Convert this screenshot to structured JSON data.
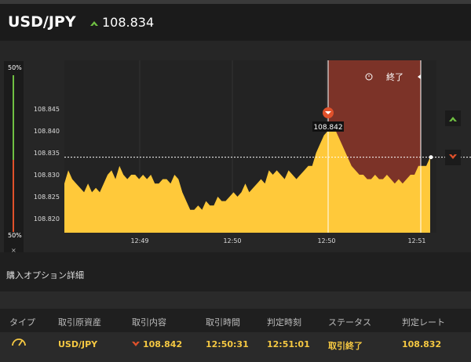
{
  "header": {
    "pair": "USD/JPY",
    "price": "108.834"
  },
  "side": {
    "top_pct": "50%",
    "bottom_pct": "50%",
    "close": "×"
  },
  "colors": {
    "area": "#ffc93a",
    "expired": "#7c3328",
    "up": "#6fbf42",
    "down": "#e0512b"
  },
  "chart_data": {
    "type": "area",
    "y_ticks": [
      "108.845",
      "108.840",
      "108.835",
      "108.830",
      "108.825",
      "108.820"
    ],
    "x_ticks": [
      "12:49",
      "12:50",
      "12:50",
      "12:51"
    ],
    "current_rate": 108.834,
    "entry_label": "108.842",
    "expired_label": "終了",
    "series": [
      108.828,
      108.831,
      108.829,
      108.828,
      108.827,
      108.826,
      108.828,
      108.826,
      108.827,
      108.826,
      108.828,
      108.83,
      108.831,
      108.829,
      108.832,
      108.83,
      108.829,
      108.83,
      108.83,
      108.829,
      108.83,
      108.829,
      108.83,
      108.828,
      108.828,
      108.829,
      108.829,
      108.828,
      108.83,
      108.829,
      108.826,
      108.824,
      108.822,
      108.822,
      108.823,
      108.822,
      108.824,
      108.823,
      108.823,
      108.825,
      108.824,
      108.824,
      108.825,
      108.826,
      108.825,
      108.826,
      108.828,
      108.826,
      108.827,
      108.828,
      108.829,
      108.828,
      108.831,
      108.83,
      108.831,
      108.83,
      108.829,
      108.831,
      108.83,
      108.829,
      108.83,
      108.831,
      108.832,
      108.832,
      108.835,
      108.837,
      108.839,
      108.84,
      108.842,
      108.84,
      108.838,
      108.836,
      108.834,
      108.832,
      108.831,
      108.83,
      108.83,
      108.829,
      108.829,
      108.83,
      108.829,
      108.829,
      108.83,
      108.829,
      108.828,
      108.829,
      108.828,
      108.829,
      108.83,
      108.83,
      108.832,
      108.832,
      108.832,
      108.834
    ]
  },
  "section": {
    "title": "購入オプション詳細"
  },
  "table": {
    "headers": [
      "タイプ",
      "取引原資産",
      "取引内容",
      "取引時間",
      "判定時刻",
      "ステータス",
      "判定レート"
    ],
    "row": {
      "asset": "USD/JPY",
      "content": "108.842",
      "trade_time": "12:50:31",
      "judge_time": "12:51:01",
      "status": "取引終了",
      "rate": "108.832"
    }
  }
}
